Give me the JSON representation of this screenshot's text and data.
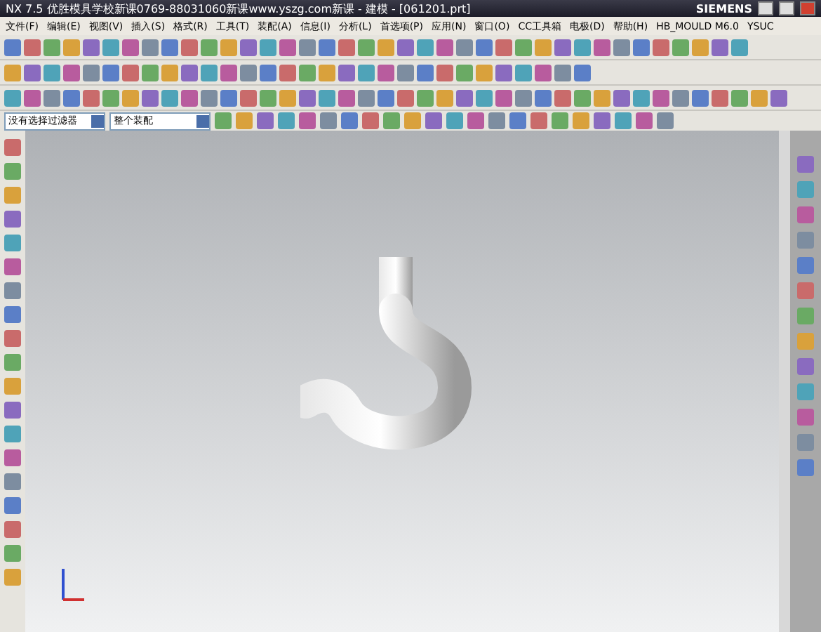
{
  "window": {
    "title": "NX 7.5 优胜模具学校新课0769-88031060新课www.yszg.com新课 - 建模 - [061201.prt]",
    "brand": "SIEMENS"
  },
  "menu_bar": [
    "文件(F)",
    "编辑(E)",
    "视图(V)",
    "插入(S)",
    "格式(R)",
    "工具(T)",
    "装配(A)",
    "信息(I)",
    "分析(L)",
    "首选项(P)",
    "应用(N)",
    "窗口(O)",
    "CC工具箱",
    "电极(D)",
    "帮助(H)",
    "HB_MOULD M6.0",
    "YSUC"
  ],
  "selection_bar": {
    "filter": "没有选择过滤器",
    "scope": "整个装配"
  }
}
